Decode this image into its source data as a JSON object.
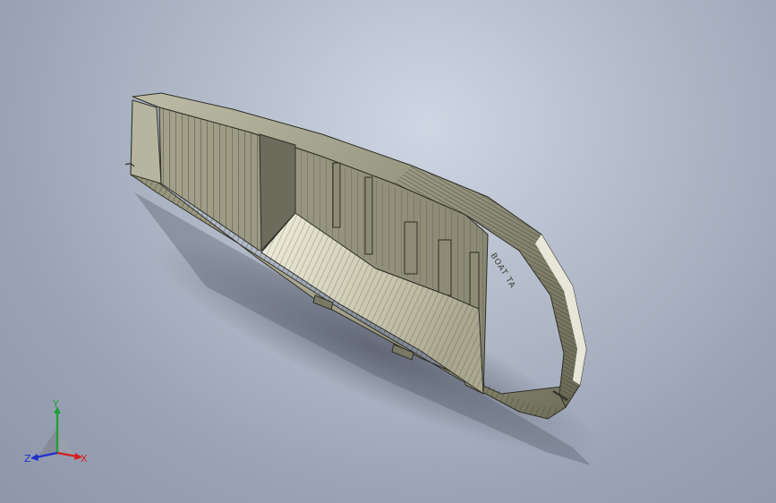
{
  "viewport": {
    "background_top": "#cfd6e3",
    "background_bottom": "#8e97aa"
  },
  "model": {
    "name": "hull-part",
    "body_color": "#9c9b84",
    "shadow_color": "#5a6070",
    "engraved_text": "BOAT TA"
  },
  "triad": {
    "x_label": "X",
    "y_label": "Y",
    "z_label": "Z",
    "x_color": "#d42020",
    "y_color": "#1fa03a",
    "z_color": "#2030d0"
  }
}
